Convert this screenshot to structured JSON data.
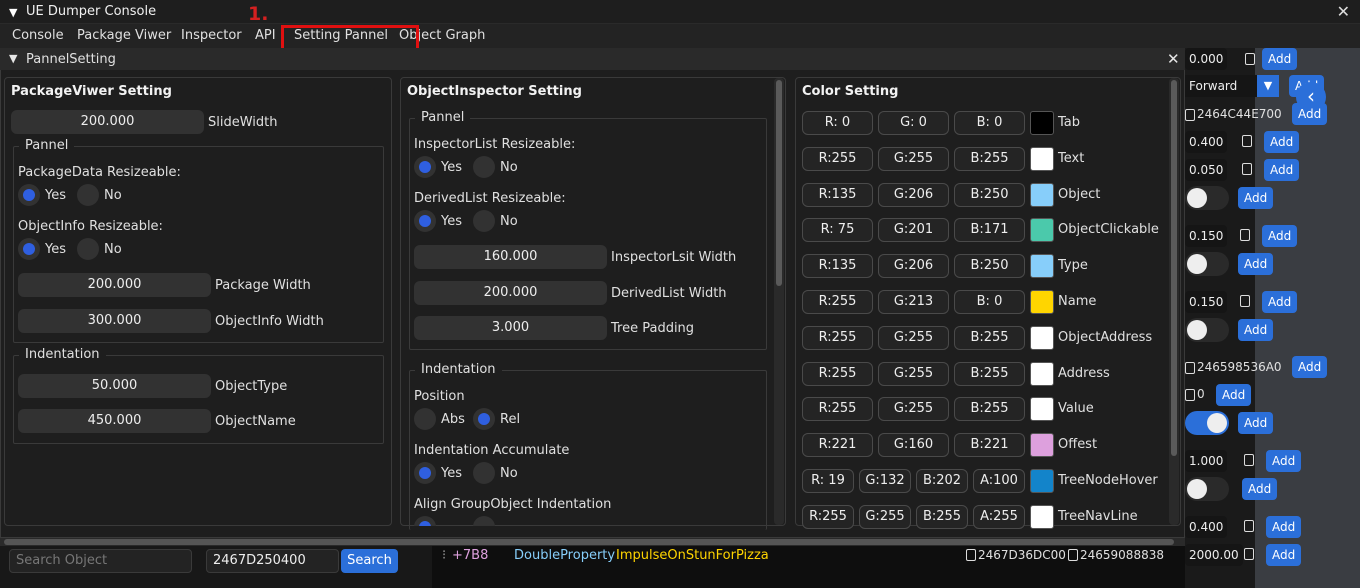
{
  "window": {
    "title": "UE Dumper Console",
    "close": "✕"
  },
  "annotation": {
    "number": "1."
  },
  "menu": [
    "Console",
    "Package Viwer",
    "Inspector",
    "API",
    "Setting Pannel",
    "Object Graph"
  ],
  "panel": {
    "title": "PannelSetting",
    "close": "✕"
  },
  "pkg": {
    "heading": "PackageViwer Setting",
    "slide_value": "200.000",
    "slide_label": "SlideWidth",
    "pannel_title": "Pannel",
    "q1": "PackageData Resizeable:",
    "q2": "ObjectInfo Resizeable:",
    "yes": "Yes",
    "no": "No",
    "pw_value": "200.000",
    "pw_label": "Package Width",
    "ow_value": "300.000",
    "ow_label": "ObjectInfo Width",
    "ind_title": "Indentation",
    "ot_value": "50.000",
    "ot_label": "ObjectType",
    "on_value": "450.000",
    "on_label": "ObjectName"
  },
  "insp": {
    "heading": "ObjectInspector Setting",
    "pannel_title": "Pannel",
    "q1": "InspectorList Resizeable:",
    "q2": "DerivedList Resizeable:",
    "yes": "Yes",
    "no": "No",
    "iw_value": "160.000",
    "iw_label": "InspectorLsit Width",
    "dw_value": "200.000",
    "dw_label": "DerivedList Width",
    "tp_value": "3.000",
    "tp_label": "Tree Padding",
    "ind_title": "Indentation",
    "pos_label": "Position",
    "abs": "Abs",
    "rel": "Rel",
    "acc_label": "Indentation Accumulate",
    "align_label": "Align GroupObject Indentation"
  },
  "colors": {
    "heading": "Color Setting",
    "rows": [
      {
        "r": "R:  0",
        "g": "G:  0",
        "b": "B:  0",
        "name": "Tab",
        "hex": "#000000"
      },
      {
        "r": "R:255",
        "g": "G:255",
        "b": "B:255",
        "name": "Text",
        "hex": "#ffffff"
      },
      {
        "r": "R:135",
        "g": "G:206",
        "b": "B:250",
        "name": "Object",
        "hex": "#87cefa"
      },
      {
        "r": "R: 75",
        "g": "G:201",
        "b": "B:171",
        "name": "ObjectClickable",
        "hex": "#4bc9ab"
      },
      {
        "r": "R:135",
        "g": "G:206",
        "b": "B:250",
        "name": "Type",
        "hex": "#87cefa"
      },
      {
        "r": "R:255",
        "g": "G:213",
        "b": "B:  0",
        "name": "Name",
        "hex": "#ffd500"
      },
      {
        "r": "R:255",
        "g": "G:255",
        "b": "B:255",
        "name": "ObjectAddress",
        "hex": "#ffffff"
      },
      {
        "r": "R:255",
        "g": "G:255",
        "b": "B:255",
        "name": "Address",
        "hex": "#ffffff"
      },
      {
        "r": "R:255",
        "g": "G:255",
        "b": "B:255",
        "name": "Value",
        "hex": "#ffffff"
      },
      {
        "r": "R:221",
        "g": "G:160",
        "b": "B:221",
        "name": "Offest",
        "hex": "#dda0dd"
      }
    ],
    "rgba_rows": [
      {
        "r": "R: 19",
        "g": "G:132",
        "b": "B:202",
        "a": "A:100",
        "name": "TreeNodeHover",
        "hex": "#1384ca"
      },
      {
        "r": "R:255",
        "g": "G:255",
        "b": "B:255",
        "a": "A:255",
        "name": "TreeNavLine",
        "hex": "#ffffff"
      }
    ]
  },
  "right": {
    "v1": "0.000",
    "forward": "Forward",
    "addr1": "2464C44E700",
    "v2": "0.400",
    "v3": "0.050",
    "v4": "0.150",
    "v5": "0.150",
    "addr2": "246598536A0",
    "v6": "0",
    "v7": "1.000",
    "v8": "0.400",
    "v9": "2000.00",
    "add": "Add",
    "add_partial": "Add"
  },
  "bottom": {
    "search_placeholder": "Search Object",
    "addr_value": "2467D250400",
    "search_btn": "Search",
    "offset": "+7B8",
    "prop_type": "DoubleProperty",
    "prop_name": "ImpulseOnStunForPizza",
    "addr_a": "2467D36DC00",
    "addr_b": "24659088838"
  }
}
